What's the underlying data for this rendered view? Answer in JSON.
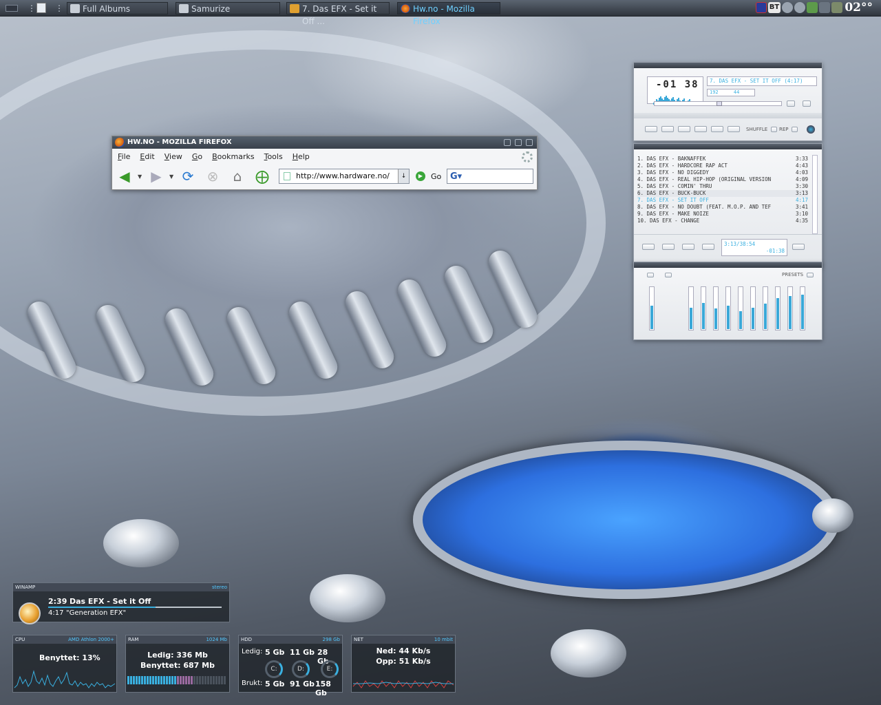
{
  "taskbar": {
    "windows": [
      {
        "label": "Full Albums",
        "active": false
      },
      {
        "label": "Samurize",
        "active": false
      },
      {
        "label": "7. Das EFX - Set it Off ...",
        "active": false
      },
      {
        "label": "Hw.no - Mozilla Firefox",
        "active": true
      }
    ],
    "tray_bt": "BT",
    "clock": "02°°"
  },
  "firefox": {
    "title": "HW.NO - MOZILLA FIREFOX",
    "menu": [
      "File",
      "Edit",
      "View",
      "Go",
      "Bookmarks",
      "Tools",
      "Help"
    ],
    "url": "http://www.hardware.no/",
    "go_label": "Go",
    "search_placeholder": ""
  },
  "winamp": {
    "time": "-01 38",
    "track_info": "7. DAS EFX - SET IT OFF (4:17)",
    "kbps": "192",
    "khz": "44",
    "shuffle_label": "SHUFFLE",
    "repeat_label": "REP",
    "playlist": [
      {
        "title": "1. DAS EFX - BAKNAFFEK",
        "time": "3:33"
      },
      {
        "title": "2. DAS EFX - HARDCORE RAP ACT",
        "time": "4:43"
      },
      {
        "title": "3. DAS EFX - NO DIGGEDY",
        "time": "4:03"
      },
      {
        "title": "4. DAS EFX - REAL HIP-HOP (ORIGINAL VERSION",
        "time": "4:09"
      },
      {
        "title": "5. DAS EFX - COMIN' THRU",
        "time": "3:30"
      },
      {
        "title": "6. DAS EFX - BUCK-BUCK",
        "time": "3:13"
      },
      {
        "title": "7. DAS EFX - SET IT OFF",
        "time": "4:17"
      },
      {
        "title": "8. DAS EFX - NO DOUBT (FEAT. M.O.P. AND TEF",
        "time": "3:41"
      },
      {
        "title": "9. DAS EFX - MAKE NOIZE",
        "time": "3:10"
      },
      {
        "title": "10. DAS EFX - CHANGE",
        "time": "4:35"
      }
    ],
    "playlist_total": "3:13/38:54",
    "playlist_remaining": "-01:38",
    "presets_label": "PRESETS",
    "eq_levels": [
      0.55,
      0.5,
      0.62,
      0.48,
      0.55,
      0.42,
      0.5,
      0.6,
      0.72,
      0.78,
      0.8
    ]
  },
  "widgets": {
    "winamp": {
      "title": "WINAMP",
      "mode": "stereo",
      "elapsed": "2:39",
      "song": "Das EFX - Set it Off",
      "length": "4:17",
      "album": "\"Generation EFX\"",
      "progress": 0.62
    },
    "cpu": {
      "title": "CPU",
      "model": "AMD Athlon 2000+",
      "label": "Benyttet: 13%"
    },
    "ram": {
      "title": "RAM",
      "total": "1024 Mb",
      "free": "Ledig: 336 Mb",
      "used": "Benyttet: 687 Mb",
      "usage": 0.67
    },
    "hdd": {
      "title": "HDD",
      "total": "298 Gb",
      "free_label": "Ledig:",
      "used_label": "Brukt:",
      "drives": [
        {
          "letter": "C:",
          "free": "5 Gb",
          "used": "5 Gb"
        },
        {
          "letter": "D:",
          "free": "11 Gb",
          "used": "91 Gb"
        },
        {
          "letter": "E:",
          "free": "28 Gb",
          "used": "158 Gb"
        }
      ]
    },
    "net": {
      "title": "NET",
      "speed": "10 mbit",
      "down": "Ned: 44 Kb/s",
      "up": "Opp: 51 Kb/s"
    }
  },
  "colors": {
    "accent": "#3ab0e0",
    "taskbar": "#3a4049",
    "widget_bg": "#1e2228"
  }
}
